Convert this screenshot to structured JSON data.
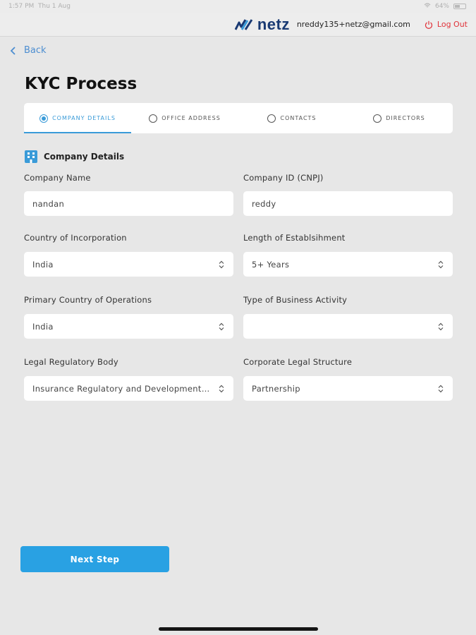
{
  "status_bar": {
    "time": "1:57 PM",
    "date": "Thu 1 Aug",
    "battery": "64%"
  },
  "header": {
    "logo_text": "netz",
    "user_email": "nreddy135+netz@gmail.com",
    "logout_label": "Log Out"
  },
  "nav": {
    "back_label": "Back"
  },
  "page": {
    "title": "KYC Process"
  },
  "steps": [
    {
      "label": "COMPANY DETAILS",
      "active": true
    },
    {
      "label": "OFFICE ADDRESS",
      "active": false
    },
    {
      "label": "CONTACTS",
      "active": false
    },
    {
      "label": "DIRECTORS",
      "active": false
    }
  ],
  "section": {
    "title": "Company Details",
    "icon": "building-icon"
  },
  "form": {
    "company_name": {
      "label": "Company Name",
      "value": "nandan"
    },
    "company_id": {
      "label": "Company ID (CNPJ)",
      "value": "reddy"
    },
    "country_incorporation": {
      "label": "Country of Incorporation",
      "value": "India"
    },
    "length_establishment": {
      "label": "Length of Establsihment",
      "value": "5+ Years"
    },
    "primary_country": {
      "label": "Primary Country of Operations",
      "value": "India"
    },
    "business_activity": {
      "label": "Type of Business Activity",
      "value": ""
    },
    "legal_body": {
      "label": "Legal Regulatory Body",
      "value": "Insurance Regulatory and Development Authority"
    },
    "legal_structure": {
      "label": "Corporate Legal Structure",
      "value": "Partnership"
    }
  },
  "actions": {
    "next_label": "Next Step"
  },
  "colors": {
    "accent": "#29a1e3",
    "brand": "#1a3a73",
    "logout": "#e0333a",
    "background": "#e7e7e7"
  }
}
